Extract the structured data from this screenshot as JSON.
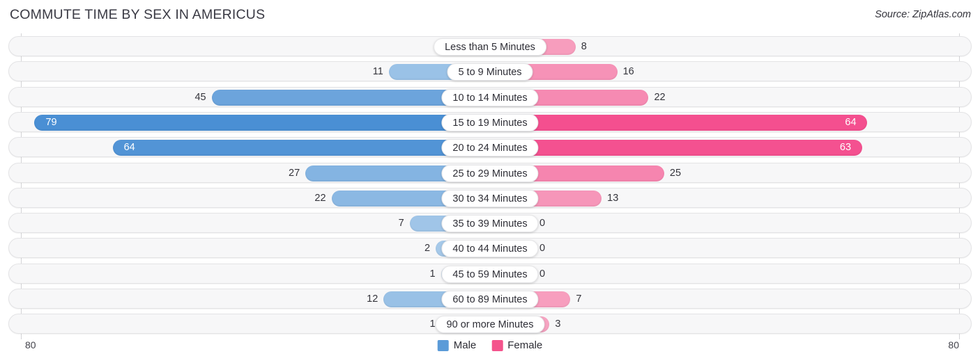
{
  "header": {
    "title": "COMMUTE TIME BY SEX IN AMERICUS",
    "source": "Source: ZipAtlas.com"
  },
  "axis": {
    "left_tick": "80",
    "right_tick": "80"
  },
  "legend": {
    "male_label": "Male",
    "female_label": "Female",
    "male_color": "#5b9bd8",
    "female_color": "#f4538c"
  },
  "chart_data": {
    "type": "bar",
    "subtype": "diverging-bar",
    "title": "COMMUTE TIME BY SEX IN AMERICUS",
    "xlabel": "",
    "ylabel": "",
    "xlim": [
      80,
      80
    ],
    "axis_max": 80,
    "grid": false,
    "legend_position": "bottom-center",
    "categories": [
      "Less than 5 Minutes",
      "5 to 9 Minutes",
      "10 to 14 Minutes",
      "15 to 19 Minutes",
      "20 to 24 Minutes",
      "25 to 29 Minutes",
      "30 to 34 Minutes",
      "35 to 39 Minutes",
      "40 to 44 Minutes",
      "45 to 59 Minutes",
      "60 to 89 Minutes",
      "90 or more Minutes"
    ],
    "series": [
      {
        "name": "Male",
        "direction": "left",
        "color": "#5b9bd8",
        "values": [
          0,
          11,
          45,
          79,
          64,
          27,
          22,
          7,
          2,
          1,
          12,
          1
        ]
      },
      {
        "name": "Female",
        "direction": "right",
        "color": "#f4538c",
        "values": [
          8,
          16,
          22,
          64,
          63,
          25,
          13,
          0,
          0,
          0,
          7,
          3
        ]
      }
    ]
  },
  "rows": [
    {
      "label": "Less than 5 Minutes",
      "male": "0",
      "female": "8"
    },
    {
      "label": "5 to 9 Minutes",
      "male": "11",
      "female": "16"
    },
    {
      "label": "10 to 14 Minutes",
      "male": "45",
      "female": "22"
    },
    {
      "label": "15 to 19 Minutes",
      "male": "79",
      "female": "64"
    },
    {
      "label": "20 to 24 Minutes",
      "male": "64",
      "female": "63"
    },
    {
      "label": "25 to 29 Minutes",
      "male": "27",
      "female": "25"
    },
    {
      "label": "30 to 34 Minutes",
      "male": "22",
      "female": "13"
    },
    {
      "label": "35 to 39 Minutes",
      "male": "7",
      "female": "0"
    },
    {
      "label": "40 to 44 Minutes",
      "male": "2",
      "female": "0"
    },
    {
      "label": "45 to 59 Minutes",
      "male": "1",
      "female": "0"
    },
    {
      "label": "60 to 89 Minutes",
      "male": "12",
      "female": "7"
    },
    {
      "label": "90 or more Minutes",
      "male": "1",
      "female": "3"
    }
  ]
}
